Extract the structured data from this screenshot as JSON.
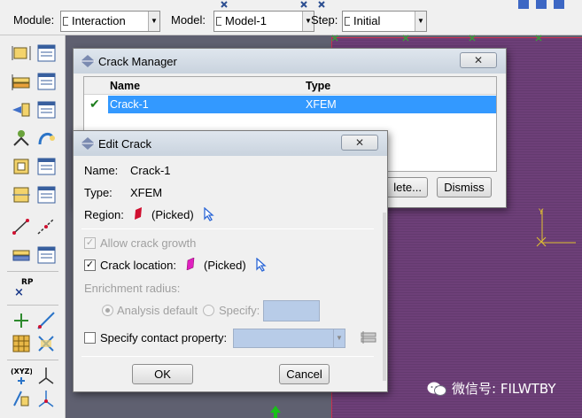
{
  "toolbar": {
    "module_label": "Module:",
    "module_value": "Interaction",
    "model_label": "Model:",
    "model_value": "Model-1",
    "step_label": "Step:",
    "step_value": "Initial"
  },
  "crack_manager": {
    "title": "Crack Manager",
    "columns": [
      "Name",
      "Type"
    ],
    "rows": [
      {
        "name": "Crack-1",
        "type": "XFEM",
        "active": true
      }
    ],
    "delete_label": "lete...",
    "dismiss_label": "Dismiss"
  },
  "edit_crack": {
    "title": "Edit Crack",
    "name_label": "Name:",
    "name_value": "Crack-1",
    "type_label": "Type:",
    "type_value": "XFEM",
    "region_label": "Region:",
    "region_value": "(Picked)",
    "allow_growth_label": "Allow crack growth",
    "allow_growth_checked": true,
    "crack_location_label": "Crack location:",
    "crack_location_value": "(Picked)",
    "crack_location_checked": true,
    "enrichment_label": "Enrichment radius:",
    "analysis_default_label": "Analysis default",
    "specify_label": "Specify:",
    "contact_label": "Specify contact property:",
    "contact_checked": false,
    "ok_label": "OK",
    "cancel_label": "Cancel"
  },
  "toolbox": {
    "rp_label": "RP",
    "xyz_label": "(XYZ)"
  },
  "axis_label": "Y",
  "watermark": "微信号: FILWTBY",
  "colors": {
    "part": "#6d3f78",
    "selection": "#3399ff",
    "region_icon": "#d01030",
    "location_icon": "#e020c0"
  }
}
